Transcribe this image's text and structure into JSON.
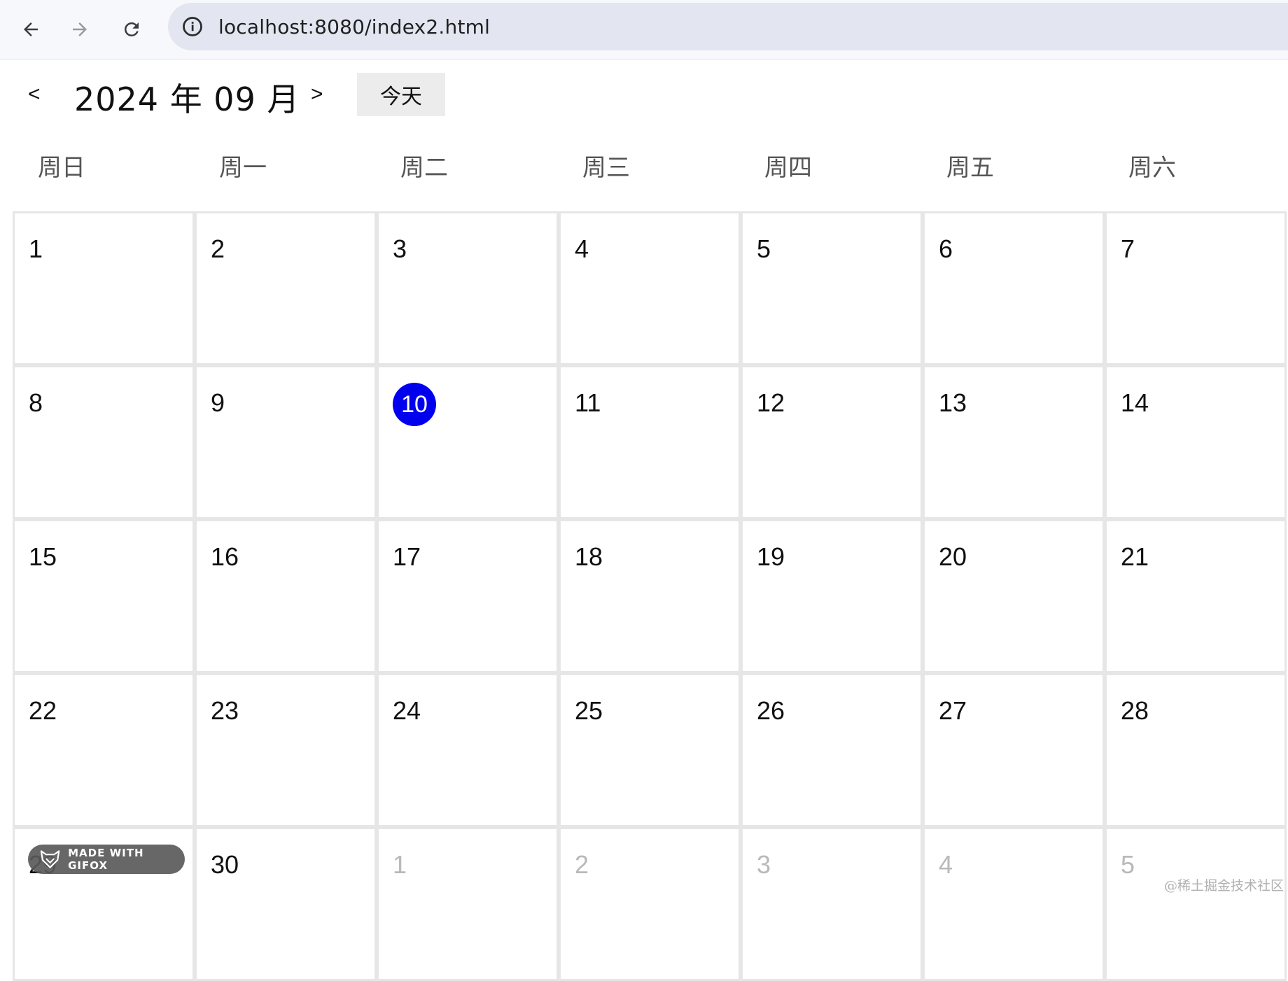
{
  "browser": {
    "url": "localhost:8080/index2.html",
    "icons": [
      "back-arrow-icon",
      "forward-arrow-icon",
      "reload-icon",
      "site-info-icon"
    ]
  },
  "calendar": {
    "prev_label": "<",
    "next_label": ">",
    "title": "2024 年 09 月",
    "today_button": "今天",
    "weekdays": [
      "周日",
      "周一",
      "周二",
      "周三",
      "周四",
      "周五",
      "周六"
    ],
    "weeks": [
      [
        {
          "d": "1",
          "other": false
        },
        {
          "d": "2",
          "other": false
        },
        {
          "d": "3",
          "other": false
        },
        {
          "d": "4",
          "other": false
        },
        {
          "d": "5",
          "other": false
        },
        {
          "d": "6",
          "other": false
        },
        {
          "d": "7",
          "other": false
        }
      ],
      [
        {
          "d": "8",
          "other": false
        },
        {
          "d": "9",
          "other": false
        },
        {
          "d": "10",
          "other": false,
          "today": true
        },
        {
          "d": "11",
          "other": false
        },
        {
          "d": "12",
          "other": false
        },
        {
          "d": "13",
          "other": false
        },
        {
          "d": "14",
          "other": false
        }
      ],
      [
        {
          "d": "15",
          "other": false
        },
        {
          "d": "16",
          "other": false
        },
        {
          "d": "17",
          "other": false
        },
        {
          "d": "18",
          "other": false
        },
        {
          "d": "19",
          "other": false
        },
        {
          "d": "20",
          "other": false
        },
        {
          "d": "21",
          "other": false
        }
      ],
      [
        {
          "d": "22",
          "other": false
        },
        {
          "d": "23",
          "other": false
        },
        {
          "d": "24",
          "other": false
        },
        {
          "d": "25",
          "other": false
        },
        {
          "d": "26",
          "other": false
        },
        {
          "d": "27",
          "other": false
        },
        {
          "d": "28",
          "other": false
        }
      ],
      [
        {
          "d": "29",
          "other": false
        },
        {
          "d": "30",
          "other": false
        },
        {
          "d": "1",
          "other": true
        },
        {
          "d": "2",
          "other": true
        },
        {
          "d": "3",
          "other": true
        },
        {
          "d": "4",
          "other": true
        },
        {
          "d": "5",
          "other": true
        }
      ]
    ],
    "today_color": "#0000ee"
  },
  "overlay": {
    "gifox_label": "MADE WITH GIFOX",
    "watermark": "@稀土掘金技术社区"
  }
}
